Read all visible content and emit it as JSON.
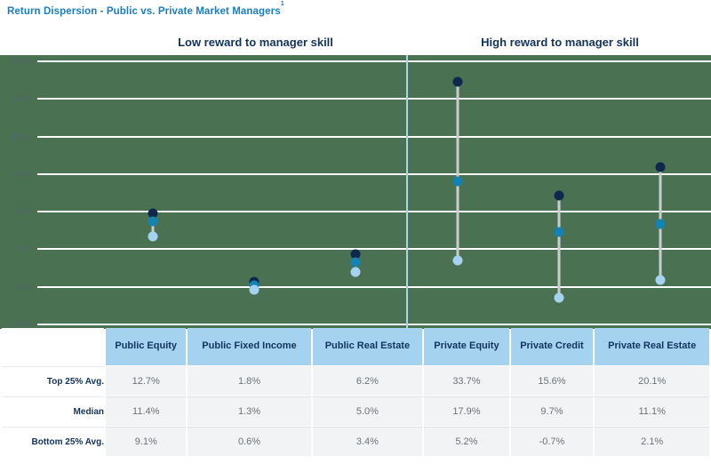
{
  "title": "Return Dispersion - Public vs. Private Market Managers",
  "title_footnote": "1",
  "sections": {
    "low": "Low reward to manager skill",
    "high": "High reward to manager skill"
  },
  "chart_data": {
    "type": "scatter",
    "title": "Return Dispersion - Public vs. Private Market Managers",
    "xlabel": "",
    "ylabel": "",
    "ylim": [
      -5.0,
      37.0
    ],
    "ytick_labels": [
      "37.0%",
      "31.0%",
      "25.0%",
      "19.0%",
      "13.0%",
      "7.0%",
      "1.0%",
      "-5.0%"
    ],
    "ytick_values": [
      37.0,
      31.0,
      25.0,
      19.0,
      13.0,
      7.0,
      1.0,
      -5.0
    ],
    "grid": true,
    "legend_position": "none",
    "categories": [
      "Public Equity",
      "Public Fixed Income",
      "Public Real Estate",
      "Private Equity",
      "Private Credit",
      "Private Real Estate"
    ],
    "series": [
      {
        "name": "Top 25% Avg.",
        "values": [
          12.7,
          1.8,
          6.2,
          33.7,
          15.6,
          20.1
        ],
        "color": "#10274d"
      },
      {
        "name": "Median",
        "values": [
          11.4,
          1.3,
          5.0,
          17.9,
          9.7,
          11.1
        ],
        "color": "#1582b4"
      },
      {
        "name": "Bottom 25% Avg.",
        "values": [
          9.1,
          0.6,
          3.4,
          5.2,
          -0.7,
          2.1
        ],
        "color": "#a5d3ef"
      }
    ],
    "annotations": [
      {
        "text": "Low reward to manager skill",
        "applies_to": [
          "Public Equity",
          "Public Fixed Income",
          "Public Real Estate"
        ]
      },
      {
        "text": "High reward to manager skill",
        "applies_to": [
          "Private Equity",
          "Private Credit",
          "Private Real Estate"
        ]
      }
    ]
  },
  "table": {
    "column_headers": [
      "Public Equity",
      "Public Fixed Income",
      "Public Real Estate",
      "Private Equity",
      "Private Credit",
      "Private Real Estate"
    ],
    "rows": [
      {
        "label": "Top 25% Avg.",
        "values": [
          "12.7%",
          "1.8%",
          "6.2%",
          "33.7%",
          "15.6%",
          "20.1%"
        ]
      },
      {
        "label": "Median",
        "values": [
          "11.4%",
          "1.3%",
          "5.0%",
          "17.9%",
          "9.7%",
          "11.1%"
        ]
      },
      {
        "label": "Bottom 25% Avg.",
        "values": [
          "9.1%",
          "0.6%",
          "3.4%",
          "5.2%",
          "-0.7%",
          "2.1%"
        ]
      }
    ]
  },
  "colors": {
    "title": "#1b7ec2",
    "heading": "#12335e",
    "top_marker": "#10274d",
    "median_marker": "#1582b4",
    "bottom_marker": "#a5d3ef",
    "stem": "#c9ccce",
    "header_fill": "#a5d3ef",
    "cell_fill": "#f2f3f4",
    "divider": "#a9d4ea"
  }
}
